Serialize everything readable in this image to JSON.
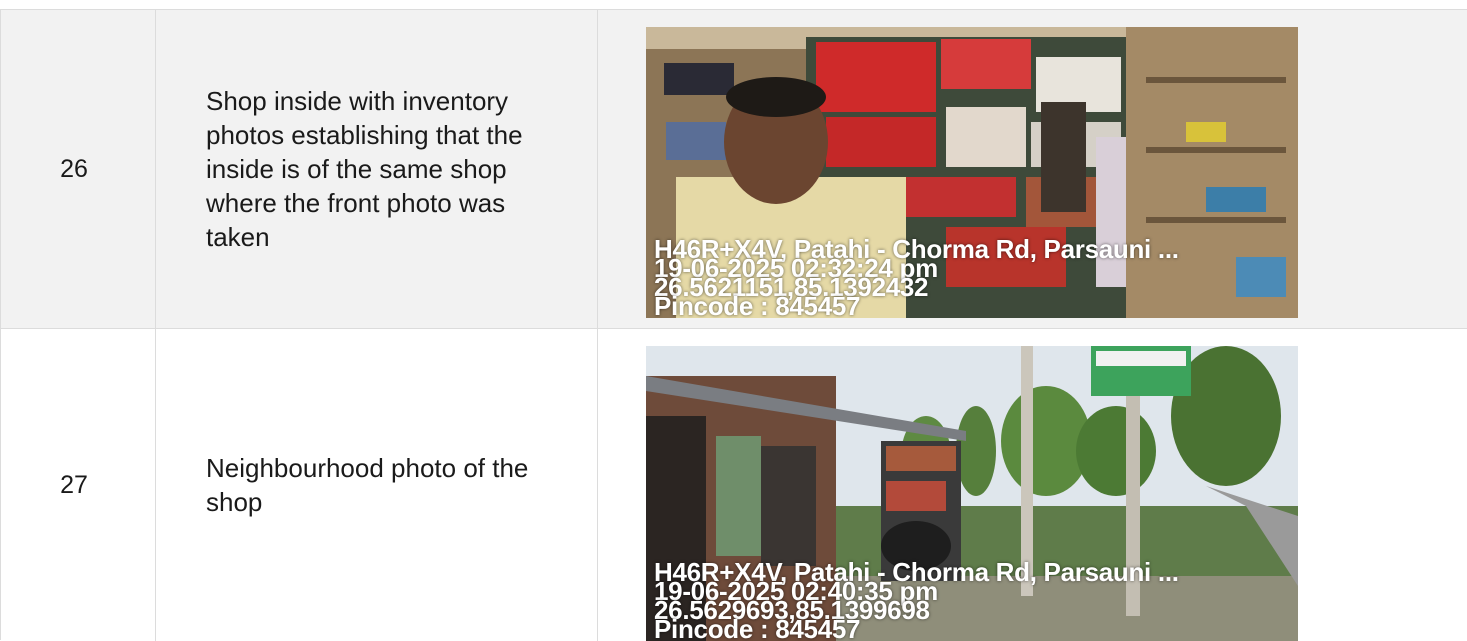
{
  "rows": [
    {
      "number": "26",
      "description": "Shop inside with inventory photos establishing that the inside is of the same shop where the front photo was taken",
      "photo": {
        "address": "H46R+X4V, Patahi - Chorma Rd, Parsauni ...",
        "datetime": "19-06-2025 02:32:24 pm",
        "coords": "26.5621151,85.1392432",
        "pincode": "Pincode : 845457"
      }
    },
    {
      "number": "27",
      "description": "Neighbourhood photo of the shop",
      "photo": {
        "address": "H46R+X4V, Patahi - Chorma Rd, Parsauni ...",
        "datetime": "19-06-2025 02:40:35 pm",
        "coords": "26.5629693,85.1399698",
        "pincode": "Pincode : 845457"
      }
    }
  ]
}
